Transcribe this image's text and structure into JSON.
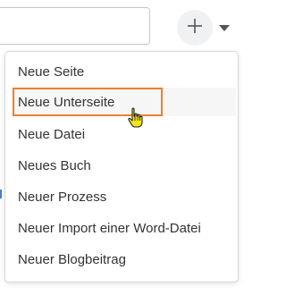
{
  "toolbar": {
    "search": {
      "value": "",
      "placeholder": ""
    },
    "add_icon": "plus-icon",
    "dropdown_icon": "caret-down-icon"
  },
  "menu": {
    "items": [
      {
        "label": "Neue Seite",
        "highlighted": false
      },
      {
        "label": "Neue Unterseite",
        "highlighted": true
      },
      {
        "label": "Neue Datei",
        "highlighted": false
      },
      {
        "label": "Neues Buch",
        "highlighted": false
      },
      {
        "label": "Neuer Prozess",
        "highlighted": false
      },
      {
        "label": "Neuer Import einer Word-Datei",
        "highlighted": false
      },
      {
        "label": "Neuer Blogbeitrag",
        "highlighted": false
      }
    ]
  },
  "colors": {
    "highlight_border": "#f07f2a",
    "text": "#333333",
    "menu_border": "#d8d8d8",
    "add_button_bg": "#f0f1f3",
    "cursor": "#f5e615"
  }
}
